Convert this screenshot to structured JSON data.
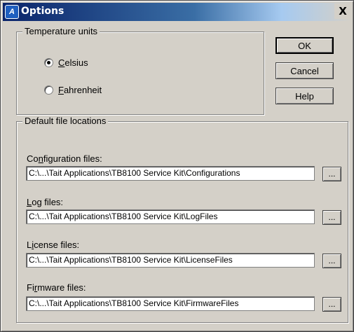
{
  "window": {
    "title": "Options",
    "icon": "tait-app-icon",
    "close_glyph": "X"
  },
  "temperature": {
    "group_label": "Temperature units",
    "options": [
      {
        "label": "Celsius",
        "accel": "C",
        "rest": "elsius",
        "selected": true
      },
      {
        "label": "Fahrenheit",
        "accel": "F",
        "rest": "ahrenheit",
        "selected": false
      }
    ]
  },
  "buttons": {
    "ok": "OK",
    "cancel": "Cancel",
    "help": "Help"
  },
  "files": {
    "group_label": "Default file locations",
    "browse_label": "...",
    "config": {
      "label_pre": "Co",
      "label_accel": "n",
      "label_post": "figuration files:",
      "value": "C:\\...\\Tait Applications\\TB8100 Service Kit\\Configurations"
    },
    "log": {
      "label_pre": "",
      "label_accel": "L",
      "label_post": "og files:",
      "value": "C:\\...\\Tait Applications\\TB8100 Service Kit\\LogFiles"
    },
    "license": {
      "label_pre": "L",
      "label_accel": "i",
      "label_post": "cense files:",
      "value": "C:\\...\\Tait Applications\\TB8100 Service Kit\\LicenseFiles"
    },
    "firmware": {
      "label_pre": "Fi",
      "label_accel": "r",
      "label_post": "mware files:",
      "value": "C:\\...\\Tait Applications\\TB8100 Service Kit\\FirmwareFiles"
    }
  }
}
